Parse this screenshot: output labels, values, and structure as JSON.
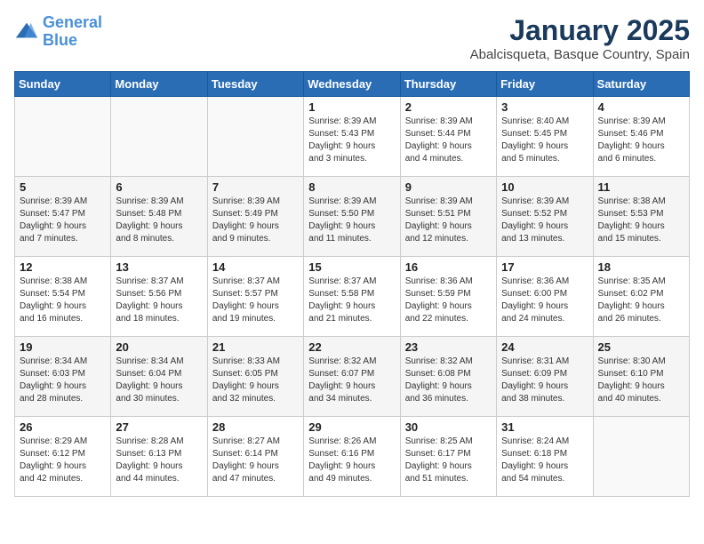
{
  "logo": {
    "line1": "General",
    "line2": "Blue"
  },
  "title": "January 2025",
  "subtitle": "Abalcisqueta, Basque Country, Spain",
  "days_of_week": [
    "Sunday",
    "Monday",
    "Tuesday",
    "Wednesday",
    "Thursday",
    "Friday",
    "Saturday"
  ],
  "weeks": [
    [
      {
        "day": "",
        "info": ""
      },
      {
        "day": "",
        "info": ""
      },
      {
        "day": "",
        "info": ""
      },
      {
        "day": "1",
        "info": "Sunrise: 8:39 AM\nSunset: 5:43 PM\nDaylight: 9 hours\nand 3 minutes."
      },
      {
        "day": "2",
        "info": "Sunrise: 8:39 AM\nSunset: 5:44 PM\nDaylight: 9 hours\nand 4 minutes."
      },
      {
        "day": "3",
        "info": "Sunrise: 8:40 AM\nSunset: 5:45 PM\nDaylight: 9 hours\nand 5 minutes."
      },
      {
        "day": "4",
        "info": "Sunrise: 8:39 AM\nSunset: 5:46 PM\nDaylight: 9 hours\nand 6 minutes."
      }
    ],
    [
      {
        "day": "5",
        "info": "Sunrise: 8:39 AM\nSunset: 5:47 PM\nDaylight: 9 hours\nand 7 minutes."
      },
      {
        "day": "6",
        "info": "Sunrise: 8:39 AM\nSunset: 5:48 PM\nDaylight: 9 hours\nand 8 minutes."
      },
      {
        "day": "7",
        "info": "Sunrise: 8:39 AM\nSunset: 5:49 PM\nDaylight: 9 hours\nand 9 minutes."
      },
      {
        "day": "8",
        "info": "Sunrise: 8:39 AM\nSunset: 5:50 PM\nDaylight: 9 hours\nand 11 minutes."
      },
      {
        "day": "9",
        "info": "Sunrise: 8:39 AM\nSunset: 5:51 PM\nDaylight: 9 hours\nand 12 minutes."
      },
      {
        "day": "10",
        "info": "Sunrise: 8:39 AM\nSunset: 5:52 PM\nDaylight: 9 hours\nand 13 minutes."
      },
      {
        "day": "11",
        "info": "Sunrise: 8:38 AM\nSunset: 5:53 PM\nDaylight: 9 hours\nand 15 minutes."
      }
    ],
    [
      {
        "day": "12",
        "info": "Sunrise: 8:38 AM\nSunset: 5:54 PM\nDaylight: 9 hours\nand 16 minutes."
      },
      {
        "day": "13",
        "info": "Sunrise: 8:37 AM\nSunset: 5:56 PM\nDaylight: 9 hours\nand 18 minutes."
      },
      {
        "day": "14",
        "info": "Sunrise: 8:37 AM\nSunset: 5:57 PM\nDaylight: 9 hours\nand 19 minutes."
      },
      {
        "day": "15",
        "info": "Sunrise: 8:37 AM\nSunset: 5:58 PM\nDaylight: 9 hours\nand 21 minutes."
      },
      {
        "day": "16",
        "info": "Sunrise: 8:36 AM\nSunset: 5:59 PM\nDaylight: 9 hours\nand 22 minutes."
      },
      {
        "day": "17",
        "info": "Sunrise: 8:36 AM\nSunset: 6:00 PM\nDaylight: 9 hours\nand 24 minutes."
      },
      {
        "day": "18",
        "info": "Sunrise: 8:35 AM\nSunset: 6:02 PM\nDaylight: 9 hours\nand 26 minutes."
      }
    ],
    [
      {
        "day": "19",
        "info": "Sunrise: 8:34 AM\nSunset: 6:03 PM\nDaylight: 9 hours\nand 28 minutes."
      },
      {
        "day": "20",
        "info": "Sunrise: 8:34 AM\nSunset: 6:04 PM\nDaylight: 9 hours\nand 30 minutes."
      },
      {
        "day": "21",
        "info": "Sunrise: 8:33 AM\nSunset: 6:05 PM\nDaylight: 9 hours\nand 32 minutes."
      },
      {
        "day": "22",
        "info": "Sunrise: 8:32 AM\nSunset: 6:07 PM\nDaylight: 9 hours\nand 34 minutes."
      },
      {
        "day": "23",
        "info": "Sunrise: 8:32 AM\nSunset: 6:08 PM\nDaylight: 9 hours\nand 36 minutes."
      },
      {
        "day": "24",
        "info": "Sunrise: 8:31 AM\nSunset: 6:09 PM\nDaylight: 9 hours\nand 38 minutes."
      },
      {
        "day": "25",
        "info": "Sunrise: 8:30 AM\nSunset: 6:10 PM\nDaylight: 9 hours\nand 40 minutes."
      }
    ],
    [
      {
        "day": "26",
        "info": "Sunrise: 8:29 AM\nSunset: 6:12 PM\nDaylight: 9 hours\nand 42 minutes."
      },
      {
        "day": "27",
        "info": "Sunrise: 8:28 AM\nSunset: 6:13 PM\nDaylight: 9 hours\nand 44 minutes."
      },
      {
        "day": "28",
        "info": "Sunrise: 8:27 AM\nSunset: 6:14 PM\nDaylight: 9 hours\nand 47 minutes."
      },
      {
        "day": "29",
        "info": "Sunrise: 8:26 AM\nSunset: 6:16 PM\nDaylight: 9 hours\nand 49 minutes."
      },
      {
        "day": "30",
        "info": "Sunrise: 8:25 AM\nSunset: 6:17 PM\nDaylight: 9 hours\nand 51 minutes."
      },
      {
        "day": "31",
        "info": "Sunrise: 8:24 AM\nSunset: 6:18 PM\nDaylight: 9 hours\nand 54 minutes."
      },
      {
        "day": "",
        "info": ""
      }
    ]
  ]
}
